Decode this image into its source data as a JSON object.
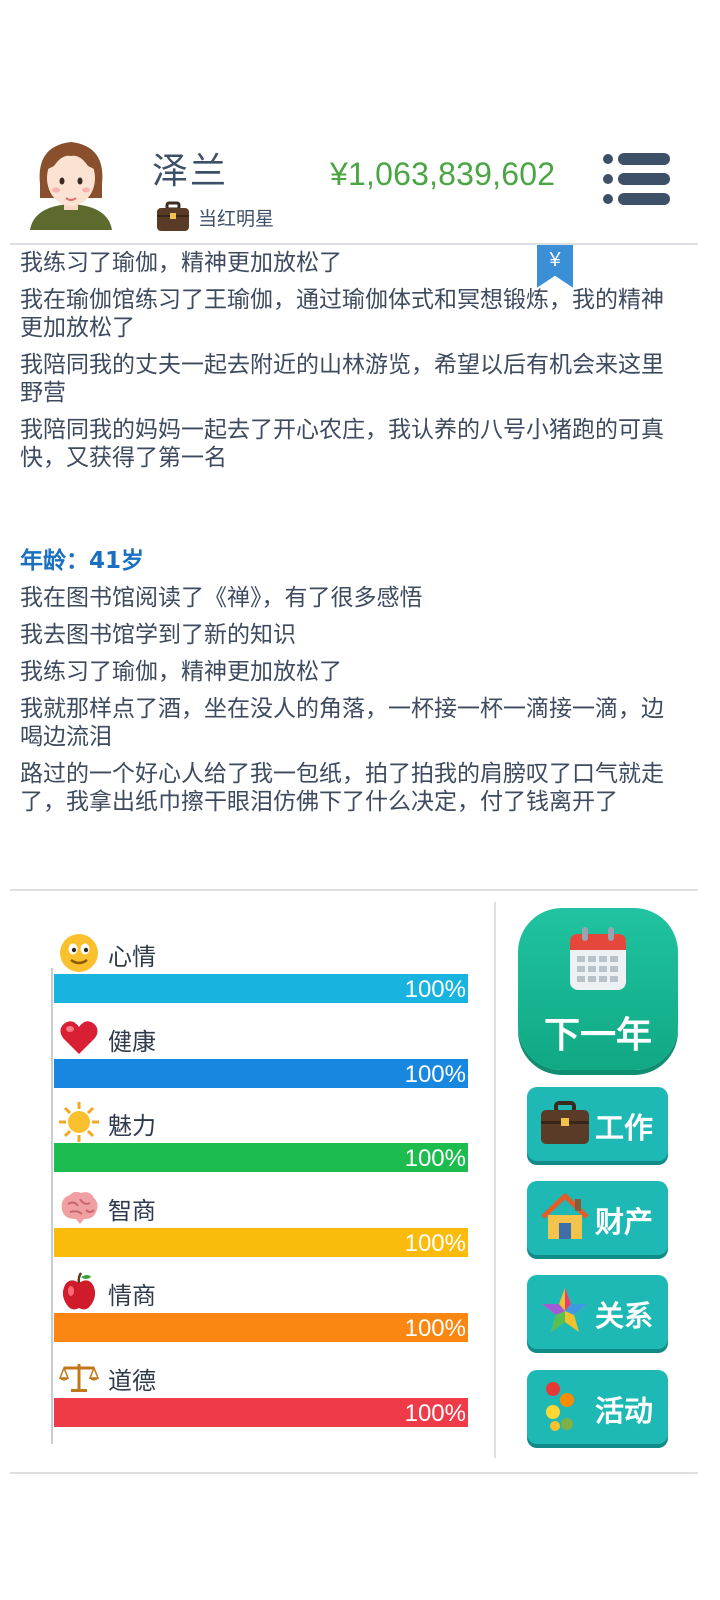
{
  "header": {
    "name": "泽兰",
    "job": "当红明星",
    "money": "¥1,063,839,602"
  },
  "bookmark": {
    "symbol": "¥"
  },
  "log": {
    "lines_before": [
      "我练习了瑜伽，精神更加放松了",
      "我在瑜伽馆练习了王瑜伽，通过瑜伽体式和冥想锻炼，我的精神更加放松了",
      "我陪同我的丈夫一起去附近的山林游览，希望以后有机会来这里野营",
      "我陪同我的妈妈一起去了开心农庄，我认养的八号小猪跑的可真快，又获得了第一名"
    ],
    "age_label": "年龄：41岁",
    "lines_after": [
      "我在图书馆阅读了《禅》，有了很多感悟",
      "我去图书馆学到了新的知识",
      "我练习了瑜伽，精神更加放松了",
      "我就那样点了酒，坐在没人的角落，一杯接一杯一滴接一滴，边喝边流泪",
      "路过的一个好心人给了我一包纸，拍了拍我的肩膀叹了口气就走了，我拿出纸巾擦干眼泪仿佛下了什么决定，付了钱离开了"
    ]
  },
  "stats": [
    {
      "name": "心情",
      "icon": "smiley-icon",
      "value": 100,
      "pct_label": "100%",
      "color": "#18b4df"
    },
    {
      "name": "健康",
      "icon": "heart-icon",
      "value": 100,
      "pct_label": "100%",
      "color": "#1787e0"
    },
    {
      "name": "魅力",
      "icon": "sun-icon",
      "value": 100,
      "pct_label": "100%",
      "color": "#1cbc4f"
    },
    {
      "name": "智商",
      "icon": "brain-icon",
      "value": 100,
      "pct_label": "100%",
      "color": "#fbbb0c"
    },
    {
      "name": "情商",
      "icon": "apple-icon",
      "value": 100,
      "pct_label": "100%",
      "color": "#fb8611"
    },
    {
      "name": "道德",
      "icon": "scales-icon",
      "value": 100,
      "pct_label": "100%",
      "color": "#ef3a48"
    }
  ],
  "actions": {
    "next_year": "下一年",
    "work": "工作",
    "property": "财产",
    "relations": "关系",
    "activities": "活动"
  }
}
